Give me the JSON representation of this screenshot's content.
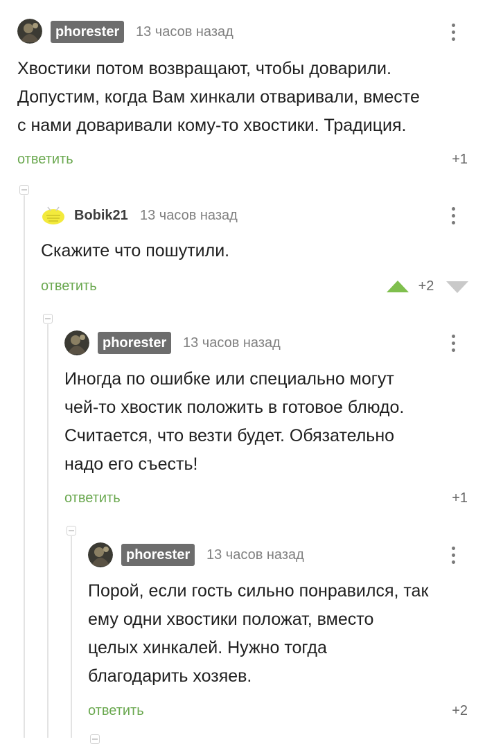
{
  "comments": [
    {
      "author": "phorester",
      "time": "13 часов назад",
      "lines": [
        "Хвостики потом возвращают, чтобы доварили.",
        "Допустим, когда Вам хинкали отваривали, вместе",
        "с нами доваривали кому-то хвостики. Традиция."
      ],
      "reply": "ответить",
      "score": "+1"
    },
    {
      "author": "Bobik21",
      "time": "13 часов назад",
      "lines": [
        "Скажите что пошутили."
      ],
      "reply": "ответить",
      "score": "+2"
    },
    {
      "author": "phorester",
      "time": "13 часов назад",
      "lines": [
        "Иногда по ошибке или специально могут",
        "чей-то хвостик положить в готовое блюдо.",
        "Считается, что везти будет. Обязательно",
        "надо его съесть!"
      ],
      "reply": "ответить",
      "score": "+1"
    },
    {
      "author": "phorester",
      "time": "13 часов назад",
      "lines": [
        "Порой, если гость сильно понравился, так",
        "ему одни хвостики положат, вместо",
        "целых хинкалей. Нужно тогда",
        "благодарить хозяев."
      ],
      "reply": "ответить",
      "score": "+2"
    }
  ],
  "colors": {
    "reply": "#6aa84f",
    "upvote": "#7fbf4d",
    "nick_badge": "#6d6d6d"
  },
  "icons": [
    "avatar-photo",
    "avatar-yellow-tag",
    "more-vertical-icon",
    "upvote-arrow-icon",
    "downvote-arrow-icon",
    "collapse-thread-icon"
  ]
}
